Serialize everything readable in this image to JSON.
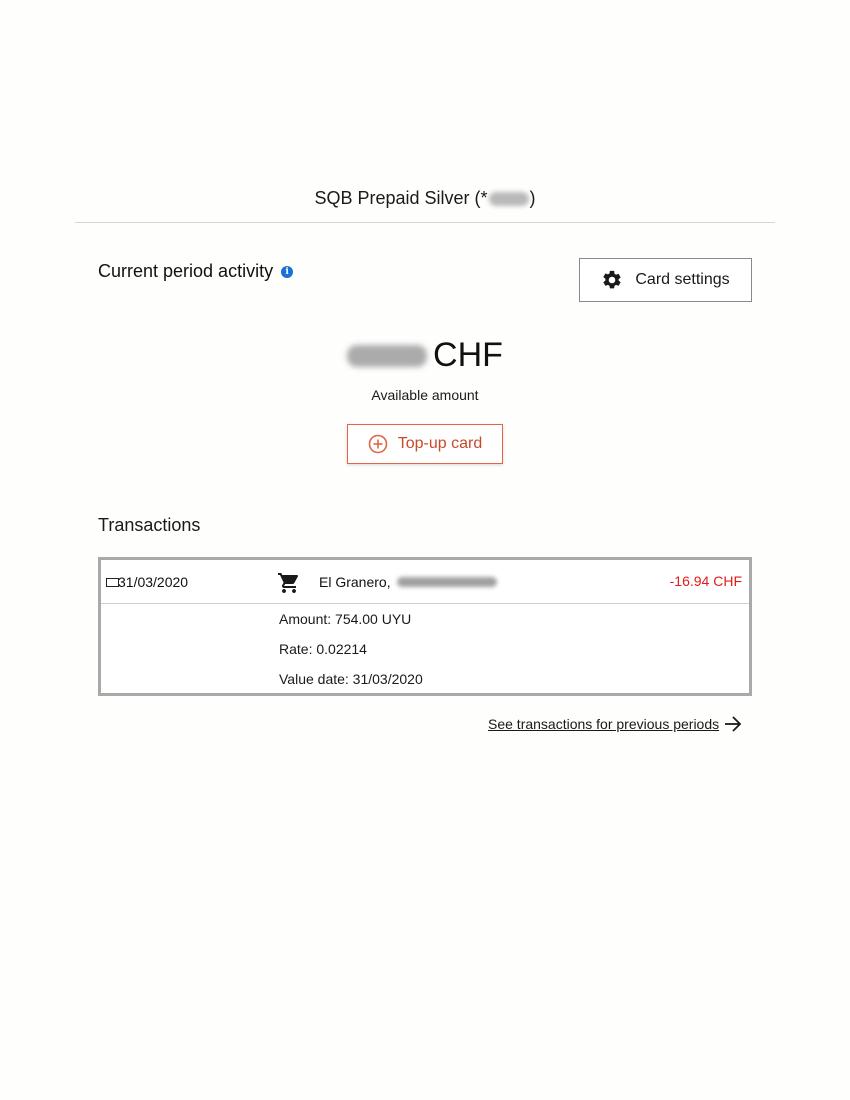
{
  "card": {
    "title_prefix": "SQB Prepaid Silver (*",
    "title_suffix": ")"
  },
  "activity": {
    "heading": "Current period activity",
    "info_icon_glyph": "i"
  },
  "settings_button": {
    "label": "Card settings",
    "icon": "gear-icon"
  },
  "balance": {
    "currency": "CHF",
    "label": "Available amount"
  },
  "topup_button": {
    "label": "Top-up card",
    "icon": "plus-circle-icon"
  },
  "transactions": {
    "heading": "Transactions",
    "items": [
      {
        "date": "31/03/2020",
        "icon": "shopping-cart-icon",
        "merchant": "El Granero,",
        "amount": "-16.94 CHF",
        "details": [
          "Amount: 754.00 UYU",
          "Rate: 0.02214",
          "Value date: 31/03/2020"
        ]
      }
    ]
  },
  "previous_link": {
    "label": "See transactions for previous periods",
    "icon": "arrow-right-icon"
  },
  "colors": {
    "accent": "#e26546",
    "negative_amount": "#e21b1b",
    "info": "#1b6fd6"
  }
}
